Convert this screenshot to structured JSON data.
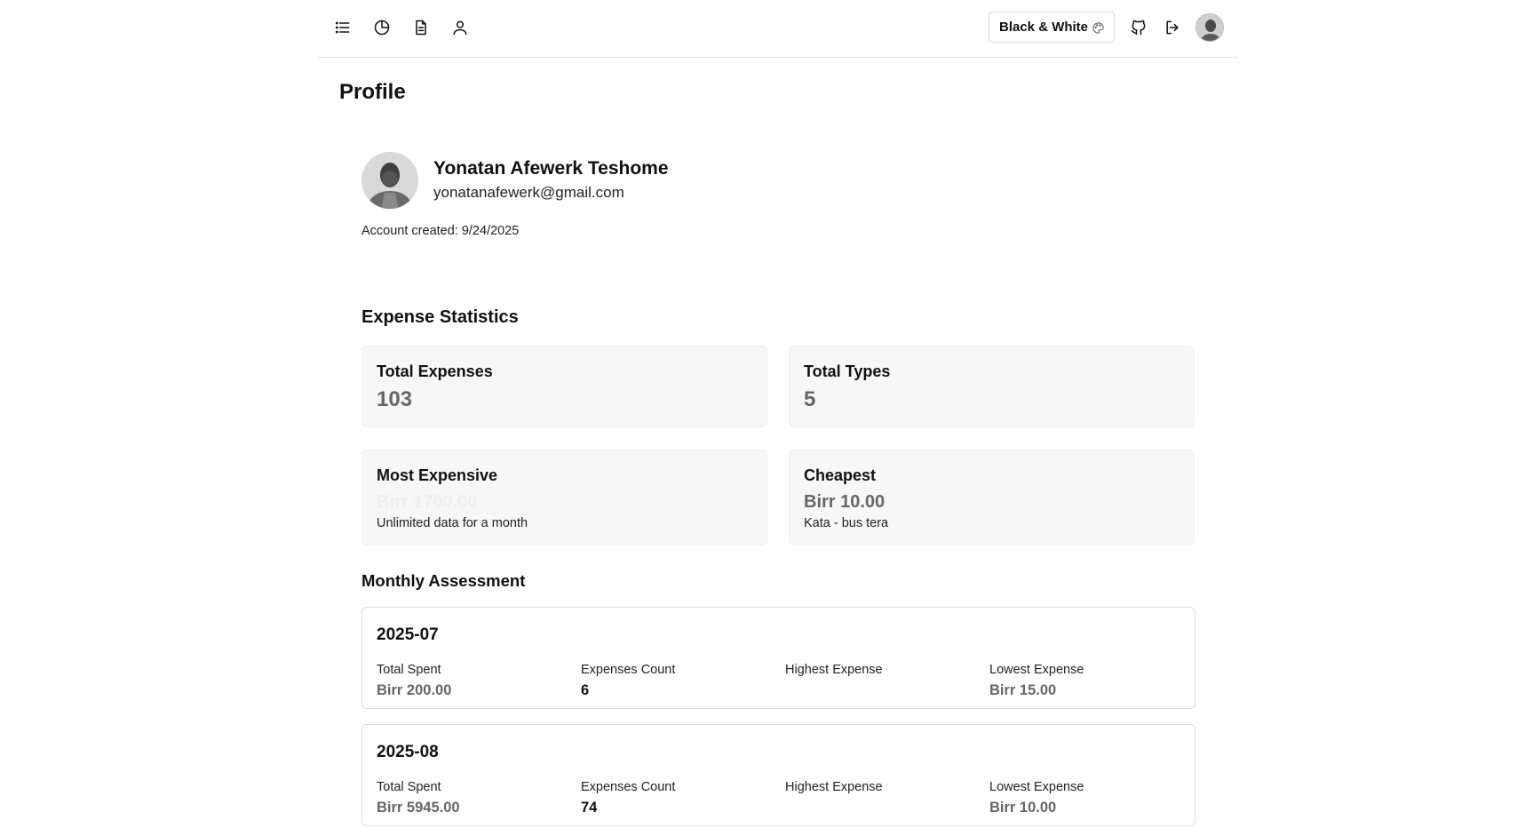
{
  "header": {
    "nav": [
      {
        "name": "list-icon"
      },
      {
        "name": "pie-chart-icon"
      },
      {
        "name": "document-icon"
      },
      {
        "name": "user-icon"
      }
    ],
    "theme_label": "Black & White",
    "theme_icon": "palette-icon",
    "github_icon": "github-icon",
    "logout_icon": "logout-icon"
  },
  "page": {
    "title": "Profile"
  },
  "profile": {
    "name": "Yonatan Afewerk Teshome",
    "email": "yonatanafewerk@gmail.com",
    "account_created": "Account created: 9/24/2025"
  },
  "stats": {
    "title": "Expense Statistics",
    "total_expenses": {
      "label": "Total Expenses",
      "value": "103"
    },
    "total_types": {
      "label": "Total Types",
      "value": "5"
    },
    "most_expensive": {
      "label": "Most Expensive",
      "amount": "Birr 1700.00",
      "description": "Unlimited data for a month"
    },
    "cheapest": {
      "label": "Cheapest",
      "amount": "Birr 10.00",
      "description": "Kata - bus tera"
    }
  },
  "monthly": {
    "title": "Monthly Assessment",
    "labels": {
      "total_spent": "Total Spent",
      "count": "Expenses Count",
      "highest": "Highest Expense",
      "lowest": "Lowest Expense"
    },
    "months": [
      {
        "month": "2025-07",
        "total_spent": "Birr 200.00",
        "count": "6",
        "highest": "",
        "lowest": "Birr 15.00"
      },
      {
        "month": "2025-08",
        "total_spent": "Birr 5945.00",
        "count": "74",
        "highest": "",
        "lowest": "Birr 10.00"
      }
    ]
  }
}
